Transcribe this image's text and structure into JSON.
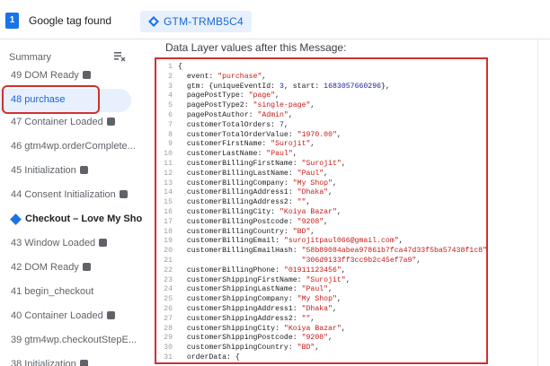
{
  "topbar": {
    "badge": "1",
    "found_label": "Google tag found",
    "container_tab": "GTM-TRMB5C4"
  },
  "sidebar": {
    "summary_label": "Summary",
    "items": [
      {
        "label": "49 DOM Ready",
        "chip": true
      },
      {
        "label": "48 purchase",
        "chip": false,
        "active": true
      },
      {
        "label": "47 Container Loaded",
        "chip": true
      },
      {
        "label": "46 gtm4wp.orderComplete...",
        "chip": false
      },
      {
        "label": "45 Initialization",
        "chip": true
      },
      {
        "label": "44 Consent Initialization",
        "chip": true
      },
      {
        "label": "Checkout – Love My Shop",
        "chip": false,
        "header": true
      },
      {
        "label": "43 Window Loaded",
        "chip": true
      },
      {
        "label": "42 DOM Ready",
        "chip": true
      },
      {
        "label": "41 begin_checkout",
        "chip": false
      },
      {
        "label": "40 Container Loaded",
        "chip": true
      },
      {
        "label": "39 gtm4wp.checkoutStepE...",
        "chip": false
      },
      {
        "label": "38 Initialization",
        "chip": true
      }
    ]
  },
  "main": {
    "title": "Data Layer values after this Message:",
    "code": [
      {
        "n": "1",
        "t": "{"
      },
      {
        "n": "2",
        "t": "  event: \"purchase\","
      },
      {
        "n": "3",
        "t": "  gtm: {uniqueEventId: 3, start: 1683057660296},"
      },
      {
        "n": "4",
        "t": "  pagePostType: \"page\","
      },
      {
        "n": "5",
        "t": "  pagePostType2: \"single-page\","
      },
      {
        "n": "6",
        "t": "  pagePostAuthor: \"Admin\","
      },
      {
        "n": "7",
        "t": "  customerTotalOrders: 7,"
      },
      {
        "n": "8",
        "t": "  customerTotalOrderValue: \"1970.00\","
      },
      {
        "n": "9",
        "t": "  customerFirstName: \"Surojit\","
      },
      {
        "n": "10",
        "t": "  customerLastName: \"Paul\","
      },
      {
        "n": "11",
        "t": "  customerBillingFirstName: \"Surojit\","
      },
      {
        "n": "12",
        "t": "  customerBillingLastName: \"Paul\","
      },
      {
        "n": "13",
        "t": "  customerBillingCompany: \"My Shop\","
      },
      {
        "n": "14",
        "t": "  customerBillingAddress1: \"Dhaka\","
      },
      {
        "n": "15",
        "t": "  customerBillingAddress2: \"\","
      },
      {
        "n": "16",
        "t": "  customerBillingCity: \"Koiya Bazar\","
      },
      {
        "n": "17",
        "t": "  customerBillingPostcode: \"9208\","
      },
      {
        "n": "18",
        "t": "  customerBillingCountry: \"BD\","
      },
      {
        "n": "19",
        "t": "  customerBillingEmail: \"surojitpaul066@gmail.com\","
      },
      {
        "n": "20",
        "t": "  customerBillingEmailHash: \"58b89084abea97861b7fca47d33f5ba57438f1c8\" +"
      },
      {
        "n": "21",
        "t": "                            \"306d9133ff3cc9b2c45ef7a9\","
      },
      {
        "n": "22",
        "t": "  customerBillingPhone: \"01911123456\","
      },
      {
        "n": "23",
        "t": "  customerShippingFirstName: \"Surojit\","
      },
      {
        "n": "24",
        "t": "  customerShippingLastName: \"Paul\","
      },
      {
        "n": "25",
        "t": "  customerShippingCompany: \"My Shop\","
      },
      {
        "n": "26",
        "t": "  customerShippingAddress1: \"Dhaka\","
      },
      {
        "n": "27",
        "t": "  customerShippingAddress2: \"\","
      },
      {
        "n": "28",
        "t": "  customerShippingCity: \"Koiya Bazar\","
      },
      {
        "n": "29",
        "t": "  customerShippingPostcode: \"9208\","
      },
      {
        "n": "30",
        "t": "  customerShippingCountry: \"BD\","
      },
      {
        "n": "31",
        "t": "  orderData: {"
      }
    ]
  },
  "colors": {
    "accent": "#1a73e8",
    "highlight": "#d32f2f",
    "string": "#c41a16"
  }
}
